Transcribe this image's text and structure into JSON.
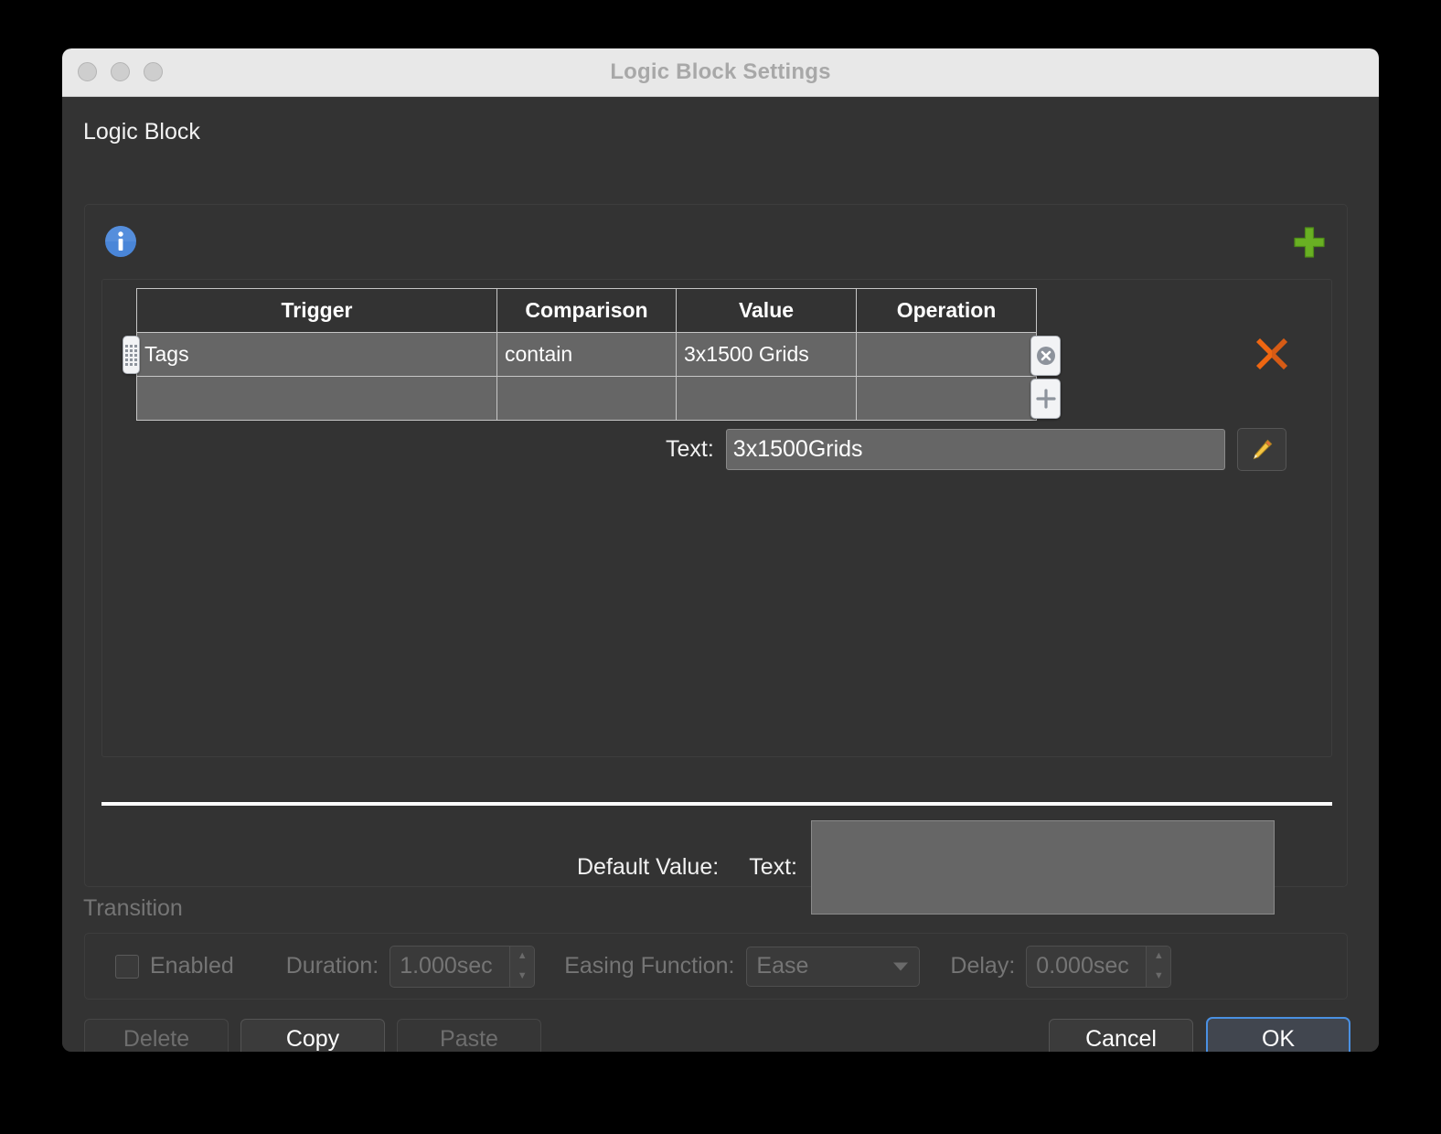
{
  "window": {
    "title": "Logic Block Settings",
    "traffic_lights": [
      "close",
      "minimize",
      "zoom"
    ]
  },
  "section": {
    "label": "Logic Block"
  },
  "toolbar": {
    "info_icon": "info-icon",
    "add_icon": "green-plus-icon",
    "delete_rule_icon": "orange-x-icon"
  },
  "table": {
    "columns": [
      "Trigger",
      "Comparison",
      "Value",
      "Operation"
    ],
    "rows": [
      {
        "trigger": "Tags",
        "comparison": "contain",
        "value": "3x1500 Grids",
        "operation": ""
      },
      {
        "trigger": "",
        "comparison": "",
        "value": "",
        "operation": ""
      }
    ],
    "remove_row_icon": "circle-x-icon",
    "add_row_icon": "plus-icon",
    "drag_handle_icon": "grip-dots-icon"
  },
  "condition_text": {
    "label": "Text:",
    "value": "3x1500Grids",
    "placeholder": "",
    "edit_icon": "pencil-icon"
  },
  "default_value": {
    "label": "Default Value:",
    "text_label": "Text:",
    "value": "",
    "placeholder": ""
  },
  "transition": {
    "group_label": "Transition",
    "enabled_label": "Enabled",
    "enabled_checked": false,
    "duration_label": "Duration:",
    "duration_value": "1.000sec",
    "easing_label": "Easing Function:",
    "easing_value": "Ease",
    "delay_label": "Delay:",
    "delay_value": "0.000sec",
    "disabled": true
  },
  "footer": {
    "delete_label": "Delete",
    "copy_label": "Copy",
    "paste_label": "Paste",
    "cancel_label": "Cancel",
    "ok_label": "OK"
  },
  "colors": {
    "dialog_bg": "#333333",
    "titlebar_bg": "#e8e8e8",
    "row_fill": "#666666",
    "accent_blue": "#4a90e2",
    "add_green": "#6fb93a",
    "delete_orange": "#e8601c",
    "disabled_text": "#757575"
  }
}
